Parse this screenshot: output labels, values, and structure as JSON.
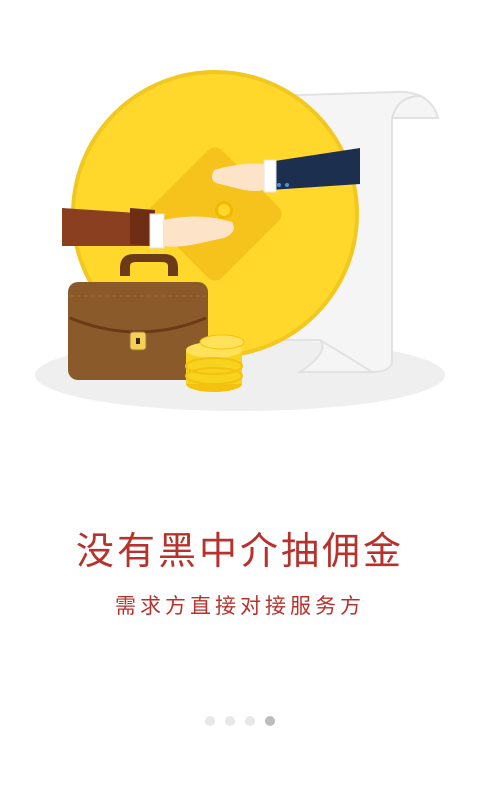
{
  "onboarding": {
    "headline": "没有黑中介抽佣金",
    "subline": "需求方直接对接服务方",
    "illustration": {
      "scene": [
        "gold-coin",
        "handshake",
        "briefcase",
        "coin-stack",
        "contract-scroll"
      ]
    },
    "pager": {
      "total": 4,
      "active_index": 3
    }
  },
  "colors": {
    "accent": "#b8322d",
    "coin": "#ffd82b",
    "dot_inactive": "#e8e8e8",
    "dot_active": "#bdbdbd"
  }
}
